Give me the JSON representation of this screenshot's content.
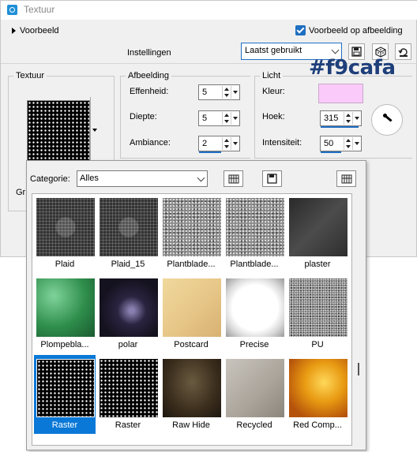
{
  "window": {
    "title": "Textuur"
  },
  "header": {
    "preview_toggle": "Voorbeeld",
    "preview_checkbox_label": "Voorbeeld op afbeelding",
    "settings_label": "Instellingen",
    "preset_value": "Laatst gebruikt"
  },
  "groups": {
    "texture_title": "Textuur",
    "image_title": "Afbeelding",
    "light_title": "Licht",
    "gr_label": "Gr"
  },
  "image": {
    "smoothness_label": "Effenheid:",
    "smoothness_value": "5",
    "depth_label": "Diepte:",
    "depth_value": "5",
    "ambiance_label": "Ambiance:",
    "ambiance_value": "2"
  },
  "light": {
    "color_label": "Kleur:",
    "color_value": "#f9cafa",
    "color_annotation": "#f9cafa",
    "angle_label": "Hoek:",
    "angle_value": "315",
    "intensity_label": "Intensiteit:",
    "intensity_value": "50"
  },
  "picker": {
    "category_label": "Categorie:",
    "category_value": "Alles",
    "tiles": [
      {
        "caption": "Plaid",
        "texture": "plaid"
      },
      {
        "caption": "Plaid_15",
        "texture": "plaid"
      },
      {
        "caption": "Plantblade...",
        "texture": "stone"
      },
      {
        "caption": "Plantblade...",
        "texture": "stone"
      },
      {
        "caption": "plaster",
        "texture": "plaster"
      },
      {
        "caption": "Plompebla...",
        "texture": "plompe"
      },
      {
        "caption": "polar",
        "texture": "polar"
      },
      {
        "caption": "Postcard",
        "texture": "postcard"
      },
      {
        "caption": "Precise",
        "texture": "precise"
      },
      {
        "caption": "PU",
        "texture": "pu"
      },
      {
        "caption": "Raster",
        "texture": "raster",
        "selected": true
      },
      {
        "caption": "Raster",
        "texture": "raster"
      },
      {
        "caption": "Raw Hide",
        "texture": "rawhide"
      },
      {
        "caption": "Recycled",
        "texture": "recycled"
      },
      {
        "caption": "Red Comp...",
        "texture": "redcomp"
      }
    ]
  }
}
